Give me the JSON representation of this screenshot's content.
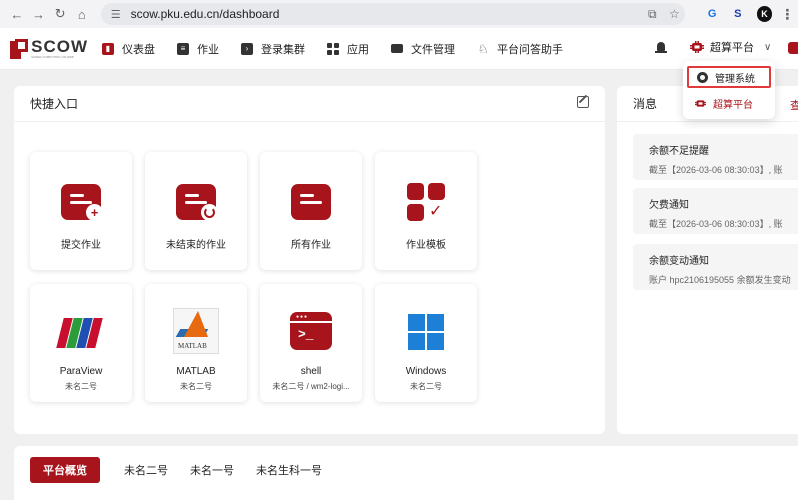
{
  "browser": {
    "url": "scow.pku.edu.cn/dashboard",
    "back": "←",
    "forward": "→",
    "reload": "↻",
    "home": "⌂"
  },
  "header": {
    "logo_text": "SCOW",
    "logo_subtext": "SUPER COMPUTING ON WEB",
    "menu": [
      {
        "label": "仪表盘",
        "icon": "dashboard-icon"
      },
      {
        "label": "作业",
        "icon": "job-icon"
      },
      {
        "label": "登录集群",
        "icon": "terminal-icon"
      },
      {
        "label": "应用",
        "icon": "apps-grid-icon"
      },
      {
        "label": "文件管理",
        "icon": "folder-icon"
      },
      {
        "label": "平台问答助手",
        "icon": "lightbulb-icon"
      }
    ],
    "platform_switch": "超算平台"
  },
  "dropdown": {
    "items": [
      {
        "label": "管理系统",
        "icon": "gear-icon"
      },
      {
        "label": "超算平台",
        "icon": "chip-icon"
      }
    ]
  },
  "quick_entry": {
    "title": "快捷入口",
    "cards": [
      {
        "label": "提交作业",
        "sub": ""
      },
      {
        "label": "未结束的作业",
        "sub": ""
      },
      {
        "label": "所有作业",
        "sub": ""
      },
      {
        "label": "作业模板",
        "sub": ""
      },
      {
        "label": "ParaView",
        "sub": "未名二号"
      },
      {
        "label": "MATLAB",
        "sub": "未名二号"
      },
      {
        "label": "shell",
        "sub": "未名二号 / wm2-logi..."
      },
      {
        "label": "Windows",
        "sub": "未名二号"
      }
    ],
    "matlab_logo_text": "MATLAB"
  },
  "messages": {
    "title": "消息",
    "more": "查",
    "items": [
      {
        "title": "余额不足提醒",
        "detail": "截至【2026-03-06 08:30:03】, 账"
      },
      {
        "title": "欠费通知",
        "detail": "截至【2026-03-06 08:30:03】, 账"
      },
      {
        "title": "余额变动通知",
        "detail": "账户 hpc2106195055 余额发生变动"
      }
    ]
  },
  "overview_tabs": [
    {
      "label": "平台概览"
    },
    {
      "label": "未名二号"
    },
    {
      "label": "未名一号"
    },
    {
      "label": "未名生科一号"
    }
  ],
  "colors": {
    "brand": "#a8141c",
    "highlight_box": "#e03a3a",
    "windows_blue": "#1e7fd6"
  }
}
